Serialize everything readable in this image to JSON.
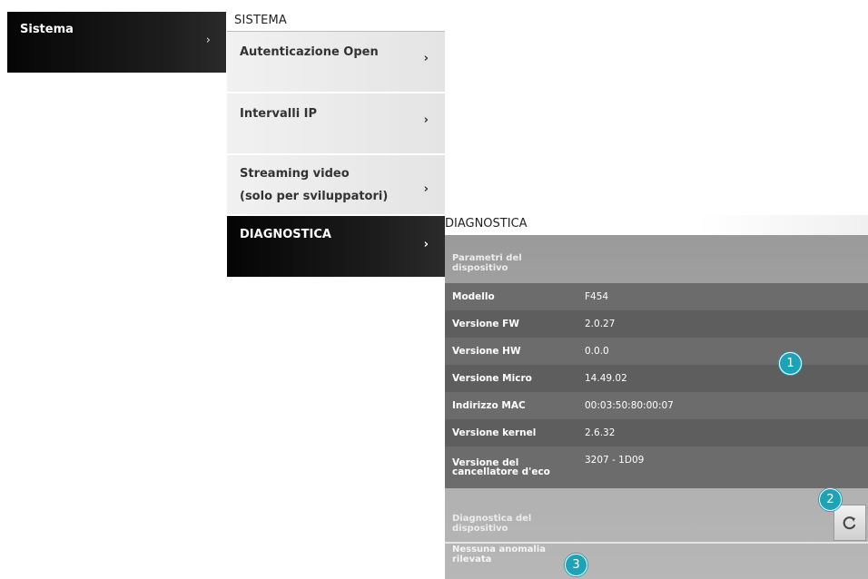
{
  "sistema_tile": {
    "label": "Sistema",
    "chevron": "›"
  },
  "sistema_menu": {
    "header": "SISTEMA",
    "items": [
      {
        "line1": "Autenticazione Open",
        "line2": "",
        "chevron": "›"
      },
      {
        "line1": "Intervalli IP",
        "line2": "",
        "chevron": "›"
      },
      {
        "line1": "Streaming video",
        "line2": "(solo per sviluppatori)",
        "chevron": "›"
      },
      {
        "line1": "DIAGNOSTICA",
        "line2": "",
        "chevron": "›"
      }
    ]
  },
  "diagnostica": {
    "header": "DIAGNOSTICA",
    "params_title": "Parametri del dispositivo",
    "params": [
      {
        "key": "Modello",
        "value": "F454"
      },
      {
        "key": "Versione FW",
        "value": "2.0.27"
      },
      {
        "key": "Versione HW",
        "value": "0.0.0"
      },
      {
        "key": "Versione Micro",
        "value": "14.49.02"
      },
      {
        "key": "Indirizzo MAC",
        "value": "00:03:50:80:00:07"
      },
      {
        "key": "Versione kernel",
        "value": "2.6.32"
      },
      {
        "key": "Versione del cancellatore d'eco",
        "value": "3207 - 1D09"
      }
    ],
    "diag_title": "Diagnostica del dispositivo",
    "status_text": "Nessuna anomalia rilevata",
    "refresh_icon": "refresh-icon"
  },
  "callouts": [
    "1",
    "2",
    "3"
  ],
  "colors": {
    "callout": "#1fa2b8",
    "active_tile": "#111111",
    "panel": "#a3a3a3"
  }
}
